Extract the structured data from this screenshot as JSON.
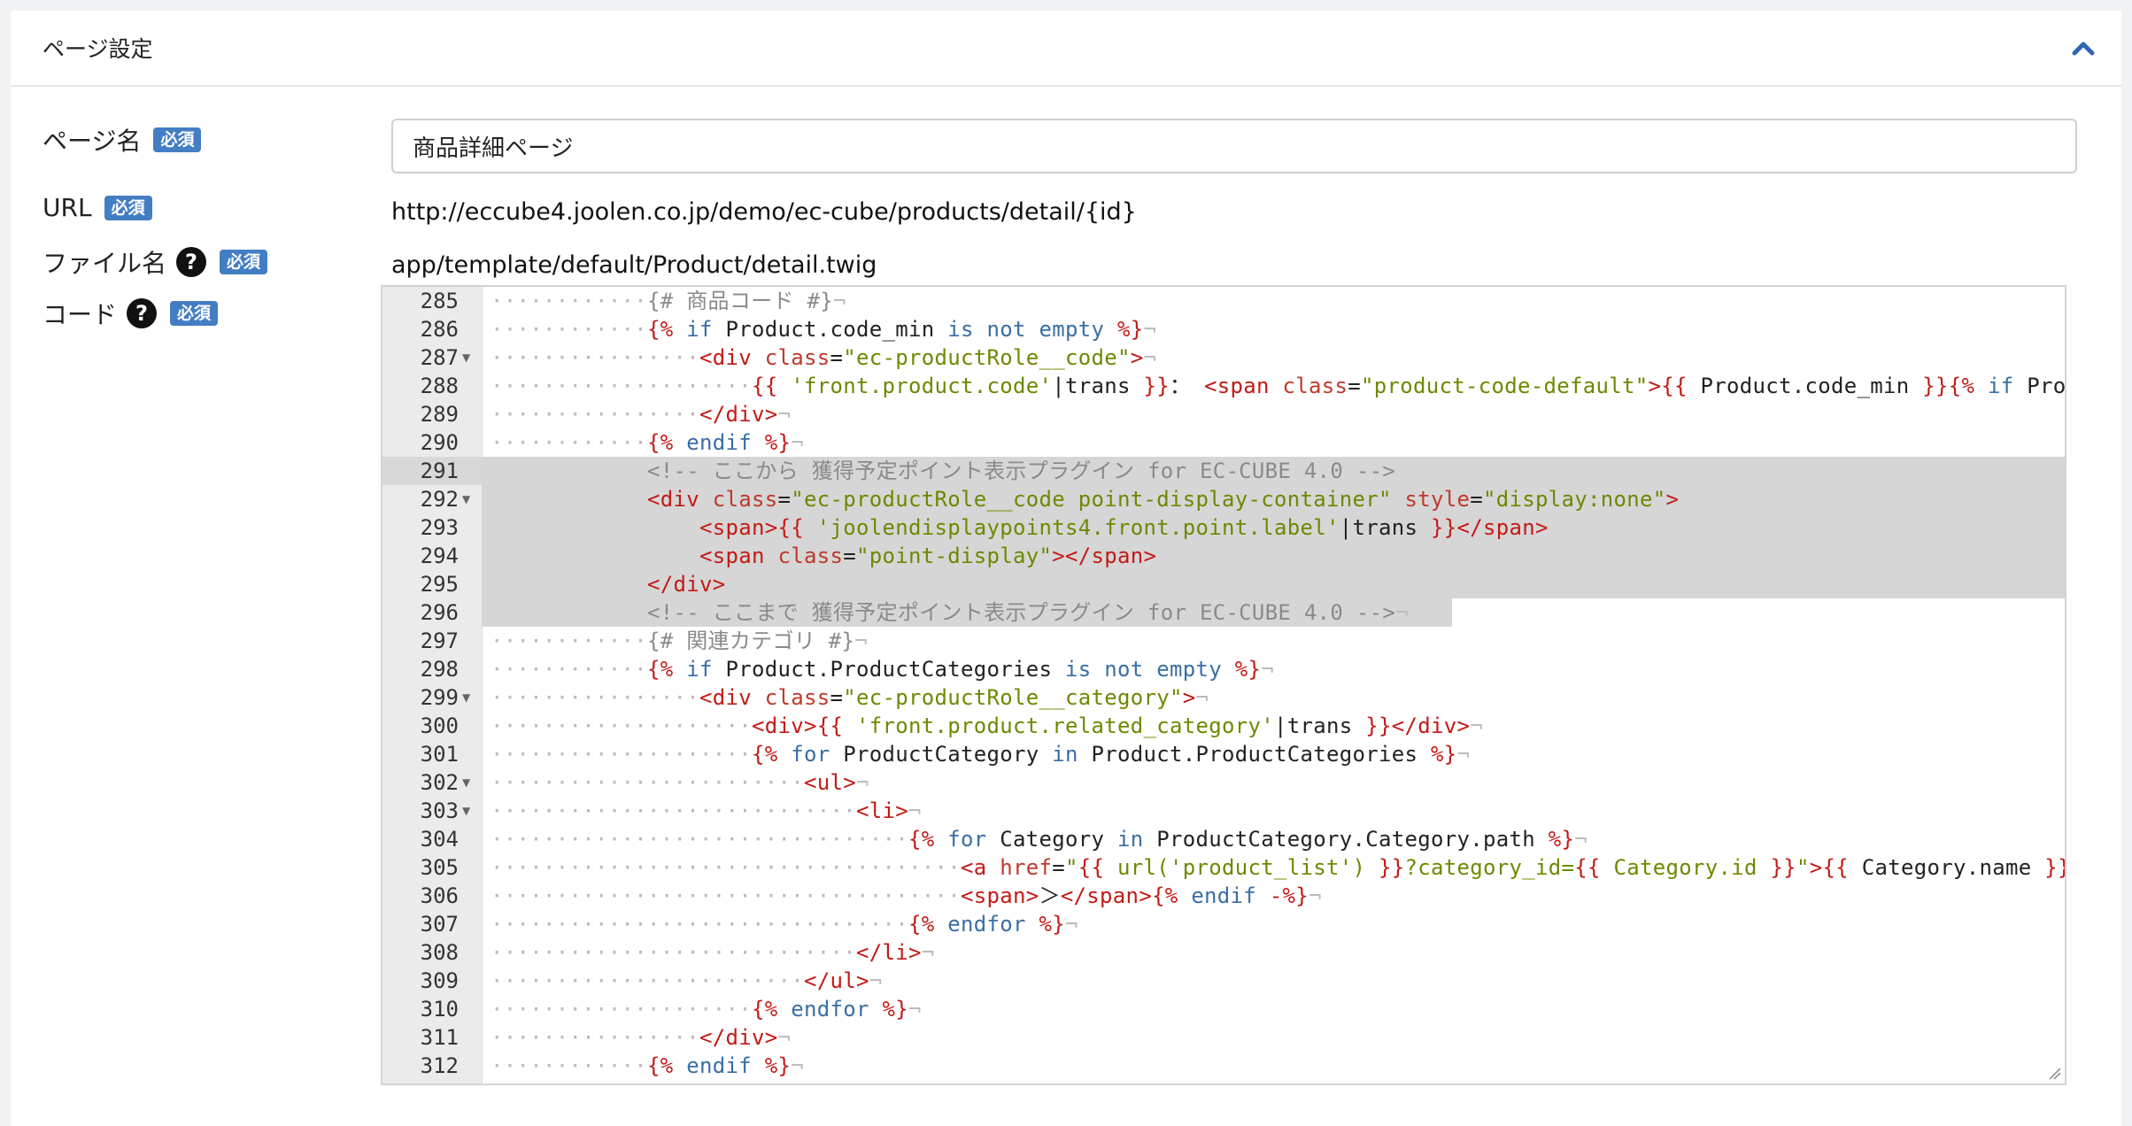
{
  "card": {
    "title": "ページ設定"
  },
  "required_badge": "必須",
  "fields": {
    "page_name": {
      "label": "ページ名",
      "value": "商品詳細ページ"
    },
    "url": {
      "label": "URL",
      "value": "http://eccube4.joolen.co.jp/demo/ec-cube/products/detail/{id}"
    },
    "file_name": {
      "label": "ファイル名",
      "value": "app/template/default/Product/detail.twig"
    },
    "code": {
      "label": "コード"
    }
  },
  "editor": {
    "lines": [
      {
        "n": "285",
        "text": "············{# 商品コード #}¬"
      },
      {
        "n": "286",
        "text": "············{% if Product.code_min is not empty %}¬"
      },
      {
        "n": "287",
        "text": "················<div class=\"ec-productRole__code\">¬",
        "fold": true
      },
      {
        "n": "288",
        "text": "····················{{ 'front.product.code'|trans }}： <span class=\"product-code-default\">{{ Product.code_min }}{% if Product"
      },
      {
        "n": "289",
        "text": "················</div>¬"
      },
      {
        "n": "290",
        "text": "············{% endif %}¬"
      },
      {
        "n": "291",
        "text": "            <!-- ここから 獲得予定ポイント表示プラグイン for EC-CUBE 4.0 -->"
      },
      {
        "n": "292",
        "text": "            <div class=\"ec-productRole__code point-display-container\" style=\"display:none\">",
        "fold": true
      },
      {
        "n": "293",
        "text": "                <span>{{ 'joolendisplaypoints4.front.point.label'|trans }}</span>"
      },
      {
        "n": "294",
        "text": "                <span class=\"point-display\"></span>"
      },
      {
        "n": "295",
        "text": "            </div>"
      },
      {
        "n": "296",
        "text": "            <!-- ここまで 獲得予定ポイント表示プラグイン for EC-CUBE 4.0 -->¬"
      },
      {
        "n": "297",
        "text": "············{# 関連カテゴリ #}¬"
      },
      {
        "n": "298",
        "text": "············{% if Product.ProductCategories is not empty %}¬"
      },
      {
        "n": "299",
        "text": "················<div class=\"ec-productRole__category\">¬",
        "fold": true
      },
      {
        "n": "300",
        "text": "····················<div>{{ 'front.product.related_category'|trans }}</div>¬"
      },
      {
        "n": "301",
        "text": "····················{% for ProductCategory in Product.ProductCategories %}¬"
      },
      {
        "n": "302",
        "text": "························<ul>¬",
        "fold": true
      },
      {
        "n": "303",
        "text": "····························<li>¬",
        "fold": true
      },
      {
        "n": "304",
        "text": "································{% for Category in ProductCategory.Category.path %}¬"
      },
      {
        "n": "305",
        "text": "····································<a href=\"{{ url('product_list') }}?category_id={{ Category.id }}\">{{ Category.name }}</a>"
      },
      {
        "n": "306",
        "text": "····································<span>＞</span>{% endif -%}¬"
      },
      {
        "n": "307",
        "text": "································{% endfor %}¬"
      },
      {
        "n": "308",
        "text": "····························</li>¬"
      },
      {
        "n": "309",
        "text": "························</ul>¬"
      },
      {
        "n": "310",
        "text": "····················{% endfor %}¬"
      },
      {
        "n": "311",
        "text": "················</div>¬"
      },
      {
        "n": "312",
        "text": "············{% endif %}¬"
      }
    ]
  },
  "colors": {
    "badge": "#437ec4",
    "tag": "#c41a16",
    "string": "#6b8a00",
    "keyword": "#3a6ea5",
    "comment": "#8a8a8a",
    "highlight": "#d6d6d6"
  },
  "icons": {
    "collapse": "chevron-up-icon",
    "help": "question-circle-icon"
  }
}
